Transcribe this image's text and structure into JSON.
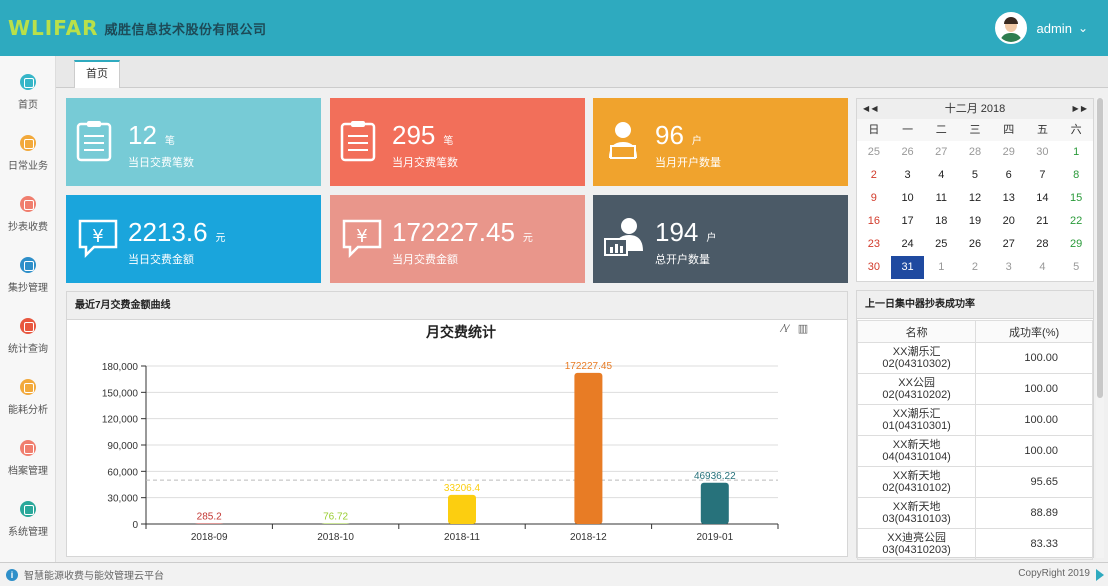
{
  "header": {
    "logo_text": "WLIFAR",
    "company": "威胜信息技术股份有限公司",
    "username": "admin"
  },
  "sidebar": {
    "items": [
      {
        "label": "首页",
        "color": "#36b6c8",
        "icon": "home-icon"
      },
      {
        "label": "日常业务",
        "color": "#f2a93b",
        "icon": "briefcase-icon"
      },
      {
        "label": "抄表收费",
        "color": "#f07e6e",
        "icon": "meter-icon"
      },
      {
        "label": "集抄管理",
        "color": "#2e8fc9",
        "icon": "bar-chart-icon"
      },
      {
        "label": "统计查询",
        "color": "#e8573f",
        "icon": "calendar-icon"
      },
      {
        "label": "能耗分析",
        "color": "#f2a93b",
        "icon": "analysis-icon"
      },
      {
        "label": "档案管理",
        "color": "#f07e6e",
        "icon": "archive-icon"
      },
      {
        "label": "系统管理",
        "color": "#2aa89a",
        "icon": "settings-icon"
      }
    ]
  },
  "tabs": [
    {
      "label": "首页"
    }
  ],
  "cards": [
    {
      "value": "12",
      "unit": "笔",
      "label": "当日交费笔数",
      "color": "#77cbd6",
      "icon": "clipboard-icon"
    },
    {
      "value": "295",
      "unit": "笔",
      "label": "当月交费笔数",
      "color": "#f26f5a",
      "icon": "clipboard-icon"
    },
    {
      "value": "96",
      "unit": "户",
      "label": "当月开户数量",
      "color": "#f0a32d",
      "icon": "person-laptop-icon"
    },
    {
      "value": "2213.6",
      "unit": "元",
      "label": "当日交费金额",
      "color": "#1aa5dc",
      "icon": "yuan-chat-icon"
    },
    {
      "value": "172227.45",
      "unit": "元",
      "label": "当月交费金额",
      "color": "#e9968b",
      "icon": "yuan-chat-icon"
    },
    {
      "value": "194",
      "unit": "户",
      "label": "总开户数量",
      "color": "#4b5a67",
      "icon": "person-chart-icon"
    }
  ],
  "calendar": {
    "title": "十二月 2018",
    "prev": "◀ ◀",
    "next": "▶ ▶",
    "weekdays": [
      "日",
      "一",
      "二",
      "三",
      "四",
      "五",
      "六"
    ],
    "weeks": [
      [
        "25",
        "26",
        "27",
        "28",
        "29",
        "30",
        "1"
      ],
      [
        "2",
        "3",
        "4",
        "5",
        "6",
        "7",
        "8"
      ],
      [
        "9",
        "10",
        "11",
        "12",
        "13",
        "14",
        "15"
      ],
      [
        "16",
        "17",
        "18",
        "19",
        "20",
        "21",
        "22"
      ],
      [
        "23",
        "24",
        "25",
        "26",
        "27",
        "28",
        "29"
      ],
      [
        "30",
        "31",
        "1",
        "2",
        "3",
        "4",
        "5"
      ]
    ],
    "selected": "31"
  },
  "chart_panel": {
    "title": "最近7月交费金额曲线"
  },
  "chart_data": {
    "type": "bar",
    "title": "月交费统计",
    "categories": [
      "2018-09",
      "2018-10",
      "2018-11",
      "2018-12",
      "2019-01"
    ],
    "values": [
      285.2,
      76.72,
      33206.4,
      172227.45,
      46936.22
    ],
    "value_labels": [
      "285.2",
      "76.72",
      "33206.4",
      "172227.45",
      "46936.22"
    ],
    "colors": [
      "#c23531",
      "#9acd32",
      "#fcce10",
      "#e87c25",
      "#27727b"
    ],
    "yticks": [
      "0",
      "30,000",
      "60,000",
      "90,000",
      "120,000",
      "150,000",
      "180,000"
    ],
    "ylim": [
      0,
      180000
    ],
    "average_line": 50000,
    "grid": true
  },
  "success_panel": {
    "title": "上一日集中器抄表成功率",
    "headers": [
      "名称",
      "成功率(%)"
    ],
    "rows": [
      {
        "name1": "XX潮乐汇",
        "name2": "02(04310302)",
        "rate": "100.00"
      },
      {
        "name1": "XX公园",
        "name2": "02(04310202)",
        "rate": "100.00"
      },
      {
        "name1": "XX潮乐汇",
        "name2": "01(04310301)",
        "rate": "100.00"
      },
      {
        "name1": "XX新天地",
        "name2": "04(04310104)",
        "rate": "100.00"
      },
      {
        "name1": "XX新天地",
        "name2": "02(04310102)",
        "rate": "95.65"
      },
      {
        "name1": "XX新天地",
        "name2": "03(04310103)",
        "rate": "88.89"
      },
      {
        "name1": "XX迪亮公园",
        "name2": "03(04310203)",
        "rate": "83.33"
      }
    ]
  },
  "footer": {
    "left": "智慧能源收费与能效管理云平台",
    "right": "CopyRight 2019"
  }
}
